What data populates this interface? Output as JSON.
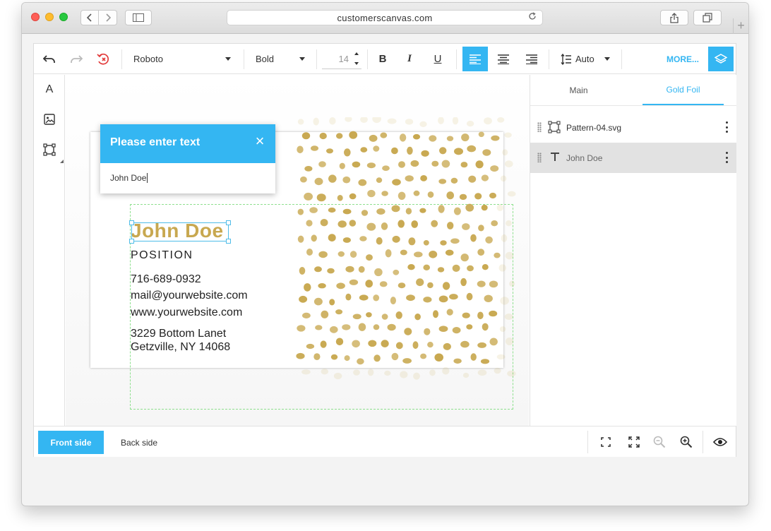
{
  "browser": {
    "url": "customerscanvas.com",
    "new_tab": "+"
  },
  "toolbar": {
    "font_family": "Roboto",
    "font_weight": "Bold",
    "font_size": "14",
    "bold": "B",
    "italic": "I",
    "underline": "U",
    "line_height": "Auto",
    "more": "MORE..."
  },
  "left_tools": {
    "text": "A"
  },
  "popup": {
    "title": "Please enter text",
    "value": "John Doe"
  },
  "card": {
    "name": "John Doe",
    "position": "POSITION",
    "phone": "716-689-0932",
    "email": "mail@yourwebsite.com",
    "website": "www.yourwebsite.com",
    "address1": "3229 Bottom Lanet",
    "address2": "Getzville, NY 14068"
  },
  "right_panel": {
    "tabs": [
      "Main",
      "Gold Foil"
    ],
    "active_tab": "Gold Foil",
    "layers": [
      {
        "name": "Pattern-04.svg",
        "icon": "frame-icon",
        "selected": false
      },
      {
        "name": "John Doe",
        "icon": "text-icon",
        "selected": true
      }
    ]
  },
  "bottom": {
    "front": "Front side",
    "back": "Back side"
  },
  "colors": {
    "accent": "#34b6f2",
    "gold": "#c8a850",
    "selection": "#4fbce8",
    "safe_area": "#8ee08e"
  }
}
